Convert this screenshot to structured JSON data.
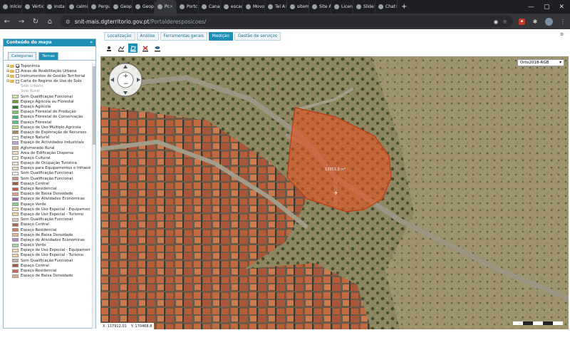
{
  "browser": {
    "tabs": [
      {
        "label": "Início"
      },
      {
        "label": "Vértic"
      },
      {
        "label": "Insta"
      },
      {
        "label": "calmi"
      },
      {
        "label": "Pergu"
      },
      {
        "label": "Geop"
      },
      {
        "label": "Geop"
      },
      {
        "label": "Pc"
      },
      {
        "label": "Portc"
      },
      {
        "label": "Canal"
      },
      {
        "label": "escac"
      },
      {
        "label": "Movo"
      },
      {
        "label": "Tel A"
      },
      {
        "label": "sitem"
      },
      {
        "label": "Site A"
      },
      {
        "label": "Licen"
      },
      {
        "label": "Slide"
      },
      {
        "label": "Chat"
      }
    ],
    "new_tab": "+",
    "url_host": "snit-mais.dgterritorio.gov.pt",
    "url_path": "/Portalderesposicoes/"
  },
  "sidebar": {
    "title": "Conteúdo do mapa",
    "tabs": [
      {
        "label": "Categorias",
        "active": false
      },
      {
        "label": "Temas",
        "active": true
      }
    ],
    "groups": [
      {
        "label": "Toponímia",
        "checked": true
      },
      {
        "label": "Áreas de Reabilitação Urbana",
        "checked": false
      },
      {
        "label": "Instrumentos de Gestão Territorial",
        "checked": false
      },
      {
        "label": "Carta do Regime de Uso do Solo",
        "checked": false
      }
    ],
    "legend": [
      {
        "label": "Solo urbano",
        "color": "",
        "dim": true
      },
      {
        "label": "Solo Rural",
        "color": "",
        "dim": true
      },
      {
        "label": "Sem Qualificação Funcional",
        "color": "#cfe8b0"
      },
      {
        "label": "Espaço Agrícola ou Florestal",
        "color": "#6a9a3a"
      },
      {
        "label": "Espaço Agrícola",
        "color": "#2e7d32"
      },
      {
        "label": "Espaço Florestal de Produção",
        "color": "#7cc46a"
      },
      {
        "label": "Espaço Florestal de Conservação",
        "color": "#4caf7a"
      },
      {
        "label": "Espaço Florestal",
        "color": "#5fbf7f"
      },
      {
        "label": "Espaço de Uso Múltiplo Agrícola",
        "color": "#b8d98a"
      },
      {
        "label": "Espaço de Exploração de Recursos",
        "color": "#a08a6a"
      },
      {
        "label": "Espaço Natural",
        "color": "#e8f4e0"
      },
      {
        "label": "Espaço de Actividades Industriais",
        "color": "#b9a7d6"
      },
      {
        "label": "Aglomerado Rural",
        "color": "#d9b38c"
      },
      {
        "label": "Área de Edificação Dispersa",
        "color": "#efe2c8"
      },
      {
        "label": "Espaço Cultural",
        "color": "#f6efcf"
      },
      {
        "label": "Espaço de Ocupação Turística",
        "color": "#f0e6d0"
      },
      {
        "label": "Espaço para Equipamentos e Infraestruturas",
        "color": "#e8e0c0"
      },
      {
        "label": "Sem Qualificação Funcional",
        "color": "#f2f2f2"
      },
      {
        "label": "Sem Qualificação Funcional",
        "color": "#c49a8a"
      },
      {
        "label": "Espaço Central",
        "color": "#9e5a4a"
      },
      {
        "label": "Espaço Residencial",
        "color": "#c4584a"
      },
      {
        "label": "Espaço de Baixa Densidade",
        "color": "#e2a486"
      },
      {
        "label": "Espaço de Atividades Económicas",
        "color": "#a06ab0"
      },
      {
        "label": "Espaço Verde",
        "color": "#8cc98c"
      },
      {
        "label": "Espaço de Uso Especial - Equipamentos",
        "color": "#f2e6b8"
      },
      {
        "label": "Espaço de Uso Especial - Turismo",
        "color": "#f0d6a8"
      },
      {
        "label": "Sem Qualificação Funcional",
        "color": "#d8c8c0"
      },
      {
        "label": "Espaço Central",
        "color": "#b06a5a"
      },
      {
        "label": "Espaço Residencial",
        "color": "#d07a6a"
      },
      {
        "label": "Espaço de Baixa Densidade",
        "color": "#e6b89a"
      },
      {
        "label": "Espaço de Atividades Económicas",
        "color": "#b88ac0"
      },
      {
        "label": "Espaço Verde",
        "color": "#a6d6a6"
      },
      {
        "label": "Espaço de Uso Especial - Equipamentos",
        "color": "#efe0b0"
      },
      {
        "label": "Espaço de Uso Especial - Turismo",
        "color": "#efd0a0"
      },
      {
        "label": "Sem Qualificação Funcional",
        "color": "#c8b0a8"
      },
      {
        "label": "Espaço Central",
        "color": "#a85848"
      },
      {
        "label": "Espaço Residencial",
        "color": "#cc6a5a"
      },
      {
        "label": "Espaço de Baixa Densidade",
        "color": "#dcae92"
      }
    ]
  },
  "app": {
    "tabs": [
      {
        "label": "Localização",
        "active": false
      },
      {
        "label": "Análise",
        "active": false
      },
      {
        "label": "Ferramentas gerais",
        "active": false
      },
      {
        "label": "Medição",
        "active": true
      },
      {
        "label": "Gestão de serviços",
        "active": false
      }
    ]
  },
  "map": {
    "basemap": "Orto2018-RGB",
    "coord_x": "X: 117912.01",
    "coord_y": "Y: 170468.8",
    "polygon_label": "12051.3 m²",
    "measure_color": "#e8511f"
  }
}
